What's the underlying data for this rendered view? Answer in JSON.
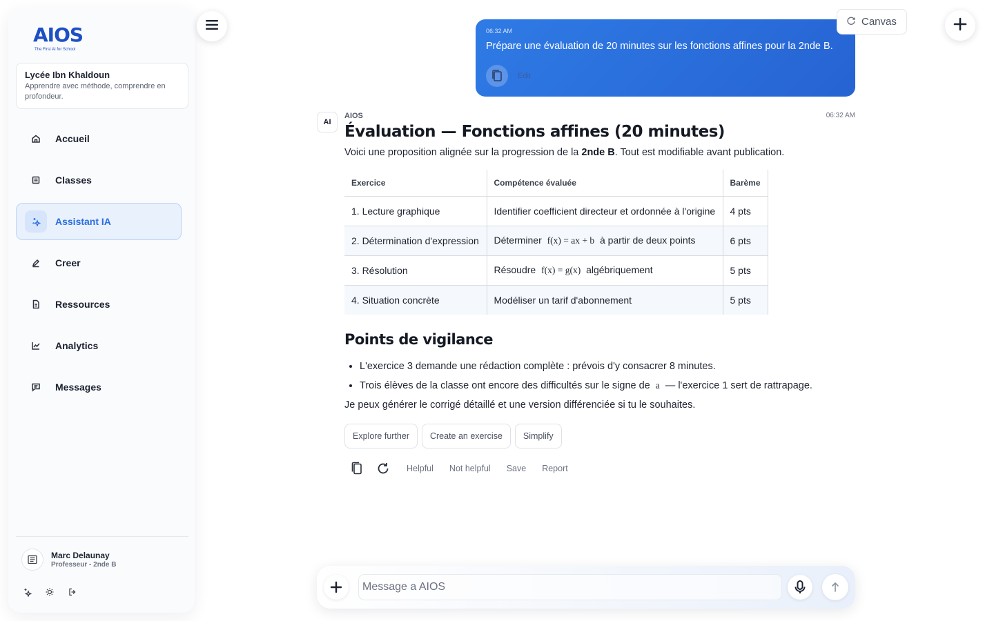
{
  "brand": {
    "name": "AIOS",
    "tagline": "The First AI for School",
    "color": "#1d4fc4"
  },
  "school": {
    "name": "Lycée Ibn Khaldoun",
    "motto": "Apprendre avec méthode, comprendre en profondeur."
  },
  "nav": {
    "items": [
      {
        "label": "Accueil",
        "icon": "home-icon",
        "active": false
      },
      {
        "label": "Classes",
        "icon": "classes-icon",
        "active": false
      },
      {
        "label": "Assistant IA",
        "icon": "sparkle-icon",
        "active": true
      },
      {
        "label": "Creer",
        "icon": "pen-icon",
        "active": false
      },
      {
        "label": "Ressources",
        "icon": "document-icon",
        "active": false
      },
      {
        "label": "Analytics",
        "icon": "chart-icon",
        "active": false
      },
      {
        "label": "Messages",
        "icon": "message-icon",
        "active": false
      }
    ],
    "active_color": "#2b6ee0"
  },
  "user": {
    "name": "Marc Delaunay",
    "role": "Professeur - 2nde B"
  },
  "toolbar": {
    "canvas_label": "Canvas"
  },
  "conversation": {
    "user_message": {
      "time": "06:32 AM",
      "text": "Prépare une évaluation de 20 minutes sur les fonctions affines pour la 2nde B.",
      "edit_label": "Edit"
    },
    "ai_message": {
      "badge": "AI",
      "sender": "AIOS",
      "time": "06:32 AM",
      "title": "Évaluation — Fonctions affines (20 minutes)",
      "intro_before": "Voici une proposition alignée sur la progression de la ",
      "intro_bold": "2nde B",
      "intro_after": ". Tout est modifiable avant publication.",
      "table": {
        "headers": [
          "Exercice",
          "Compétence évaluée",
          "Barème"
        ],
        "rows": [
          {
            "exercise": "1. Lecture graphique",
            "skill_before": "Identifier coefficient directeur et ordonnée à l'origine",
            "math": "",
            "skill_after": "",
            "points": "4 pts"
          },
          {
            "exercise": "2. Détermination d'expression",
            "skill_before": "Déterminer",
            "math": "f(x) = ax + b",
            "skill_after": "à partir de deux points",
            "points": "6 pts"
          },
          {
            "exercise": "3. Résolution",
            "skill_before": "Résoudre",
            "math": "f(x) = g(x)",
            "skill_after": "algébriquement",
            "points": "5 pts"
          },
          {
            "exercise": "4. Situation concrète",
            "skill_before": "Modéliser un tarif d'abonnement",
            "math": "",
            "skill_after": "",
            "points": "5 pts"
          }
        ]
      },
      "section_title": "Points de vigilance",
      "bullets": [
        {
          "before": "L'exercice 3 demande une rédaction complète : prévois d'y consacrer 8 minutes.",
          "math": "",
          "after": ""
        },
        {
          "before": "Trois élèves de la classe ont encore des difficultés sur le signe de",
          "math": "a",
          "after": "— l'exercice 1 sert de rattrapage."
        }
      ],
      "closing": "Je peux générer le corrigé détaillé et une version différenciée si tu le souhaites.",
      "suggestions": [
        "Explore further",
        "Create an exercise",
        "Simplify"
      ],
      "feedback": [
        "Helpful",
        "Not helpful",
        "Save",
        "Report"
      ]
    }
  },
  "composer": {
    "placeholder": "Message a AIOS"
  },
  "colors": {
    "user_bubble": "#2b6ee0",
    "accent": "#2b6ee0"
  }
}
